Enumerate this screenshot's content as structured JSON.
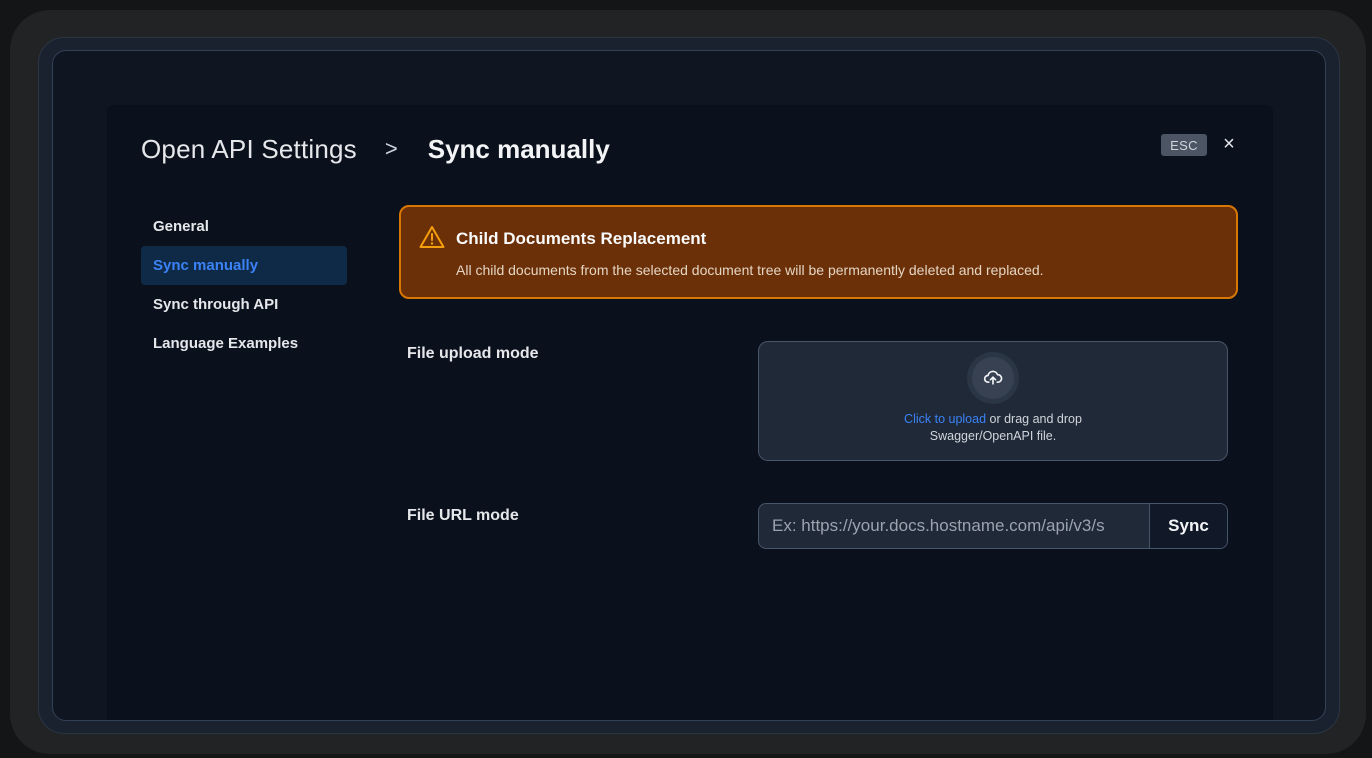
{
  "header": {
    "title": "Open API Settings",
    "separator": ">",
    "current": "Sync manually",
    "esc_label": "ESC",
    "close_glyph": "×"
  },
  "sidebar": {
    "items": [
      {
        "label": "General",
        "active": false
      },
      {
        "label": "Sync manually",
        "active": true
      },
      {
        "label": "Sync through API",
        "active": false
      },
      {
        "label": "Language Examples",
        "active": false
      }
    ]
  },
  "alert": {
    "icon": "warning-triangle-icon",
    "title": "Child Documents Replacement",
    "text": "All child documents from the selected document tree will be permanently deleted and replaced."
  },
  "upload": {
    "label": "File upload mode",
    "icon": "cloud-upload-icon",
    "link_text": "Click to upload",
    "text_after_link": " or drag and drop",
    "text_line2": "Swagger/OpenAPI file."
  },
  "url_mode": {
    "label": "File URL mode",
    "placeholder": "Ex: https://your.docs.hostname.com/api/v3/s",
    "value": "",
    "button_label": "Sync"
  },
  "colors": {
    "accent": "#3b82f6",
    "alert_bg": "#6b3008",
    "alert_border": "#d97706",
    "modal_bg": "#0b111c"
  }
}
